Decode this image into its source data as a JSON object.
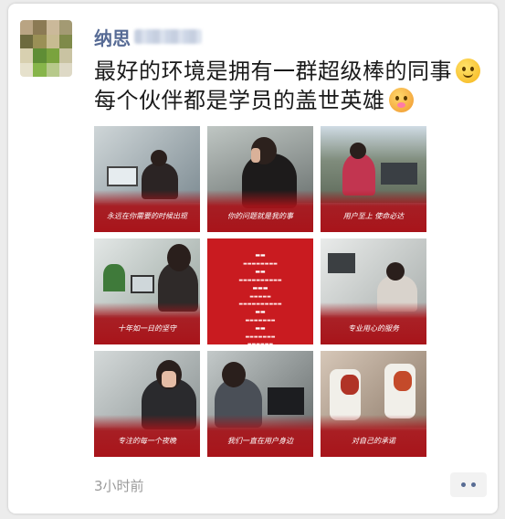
{
  "post": {
    "author": "纳思",
    "lines": [
      "最好的环境是拥有一群超级棒的同事",
      "每个伙伴都是学员的盖世英雄"
    ],
    "emoji": [
      "smiling-face-icon",
      "hot-face-icon"
    ],
    "time": "3小时前"
  },
  "tiles": [
    {
      "caption": "永远在你需要的时候出现",
      "kind": "photo"
    },
    {
      "caption": "你的问题就是我的事",
      "kind": "photo"
    },
    {
      "caption": "用户至上 使命必达",
      "kind": "photo"
    },
    {
      "caption": "十年如一日的坚守",
      "kind": "photo"
    },
    {
      "caption": "",
      "kind": "red-list"
    },
    {
      "caption": "专业用心的服务",
      "kind": "photo"
    },
    {
      "caption": "专注的每一个夜晚",
      "kind": "photo"
    },
    {
      "caption": "我们一直在用户身边",
      "kind": "photo"
    },
    {
      "caption": "对自己的承诺",
      "kind": "photo"
    }
  ],
  "colors": {
    "name": "#576b95",
    "band": "#a8141a",
    "red_tile": "#c91b20"
  }
}
